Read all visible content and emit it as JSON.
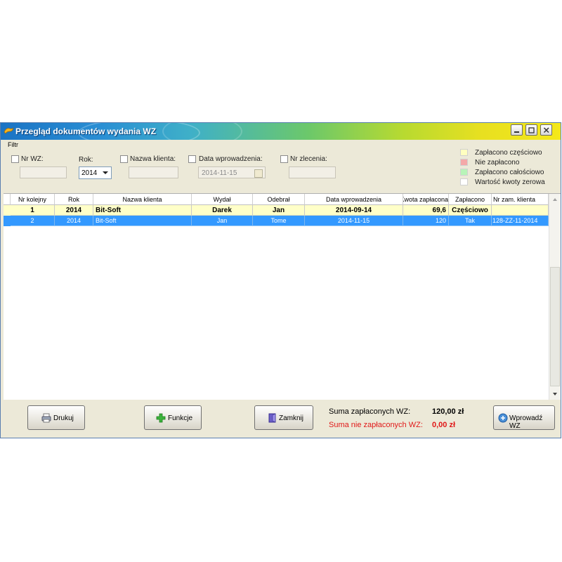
{
  "window": {
    "title": "Przegląd dokumentów wydania WZ"
  },
  "filter": {
    "title": "Filtr",
    "nr_wz_label": "Nr WZ:",
    "rok_label": "Rok:",
    "rok_value": "2014",
    "nazwa_klienta_label": "Nazwa klienta:",
    "data_wprowadzenia_label": "Data wprowadzenia:",
    "data_value": "2014-11-15",
    "nr_zlecenia_label": "Nr zlecenia:"
  },
  "legend": [
    {
      "label": "Zapłacono częściowo",
      "color": "#ffffc0"
    },
    {
      "label": "Nie zapłacono",
      "color": "#f4a8a8"
    },
    {
      "label": "Zapłacono całościowo",
      "color": "#b8f4b8"
    },
    {
      "label": "Wartość kwoty zerowa",
      "color": "#ffffff"
    }
  ],
  "table": {
    "columns": [
      "Nr kolejny",
      "Rok",
      "Nazwa klienta",
      "Wydał",
      "Odebrał",
      "Data wprowadzenia",
      "Kwota zapłacona",
      "Zapłacono",
      "Nr zam. klienta"
    ],
    "rows": [
      [
        "1",
        "2014",
        "Bit-Soft",
        "Darek",
        "Jan",
        "2014-09-14",
        "69,6",
        "Częściowo",
        ""
      ],
      [
        "2",
        "2014",
        "Bit-Soft",
        "Jan",
        "Tome",
        "2014-11-15",
        "120",
        "Tak",
        "128-ZZ-11-2014"
      ]
    ]
  },
  "buttons": {
    "drukuj": "Drukuj",
    "funkcje": "Funkcje",
    "zamknij": "Zamknij",
    "wprowadz": "Wprowadź WZ"
  },
  "summary": {
    "paid_label": "Suma zapłaconych WZ:",
    "paid_value": "120,00 zł",
    "unpaid_label": "Suma nie zapłaconych WZ:",
    "unpaid_value": "0,00 zł"
  },
  "colors": {
    "selected_row": "#3399ff",
    "partial_row": "#ffffc8",
    "unpaid_text": "#e01818"
  }
}
